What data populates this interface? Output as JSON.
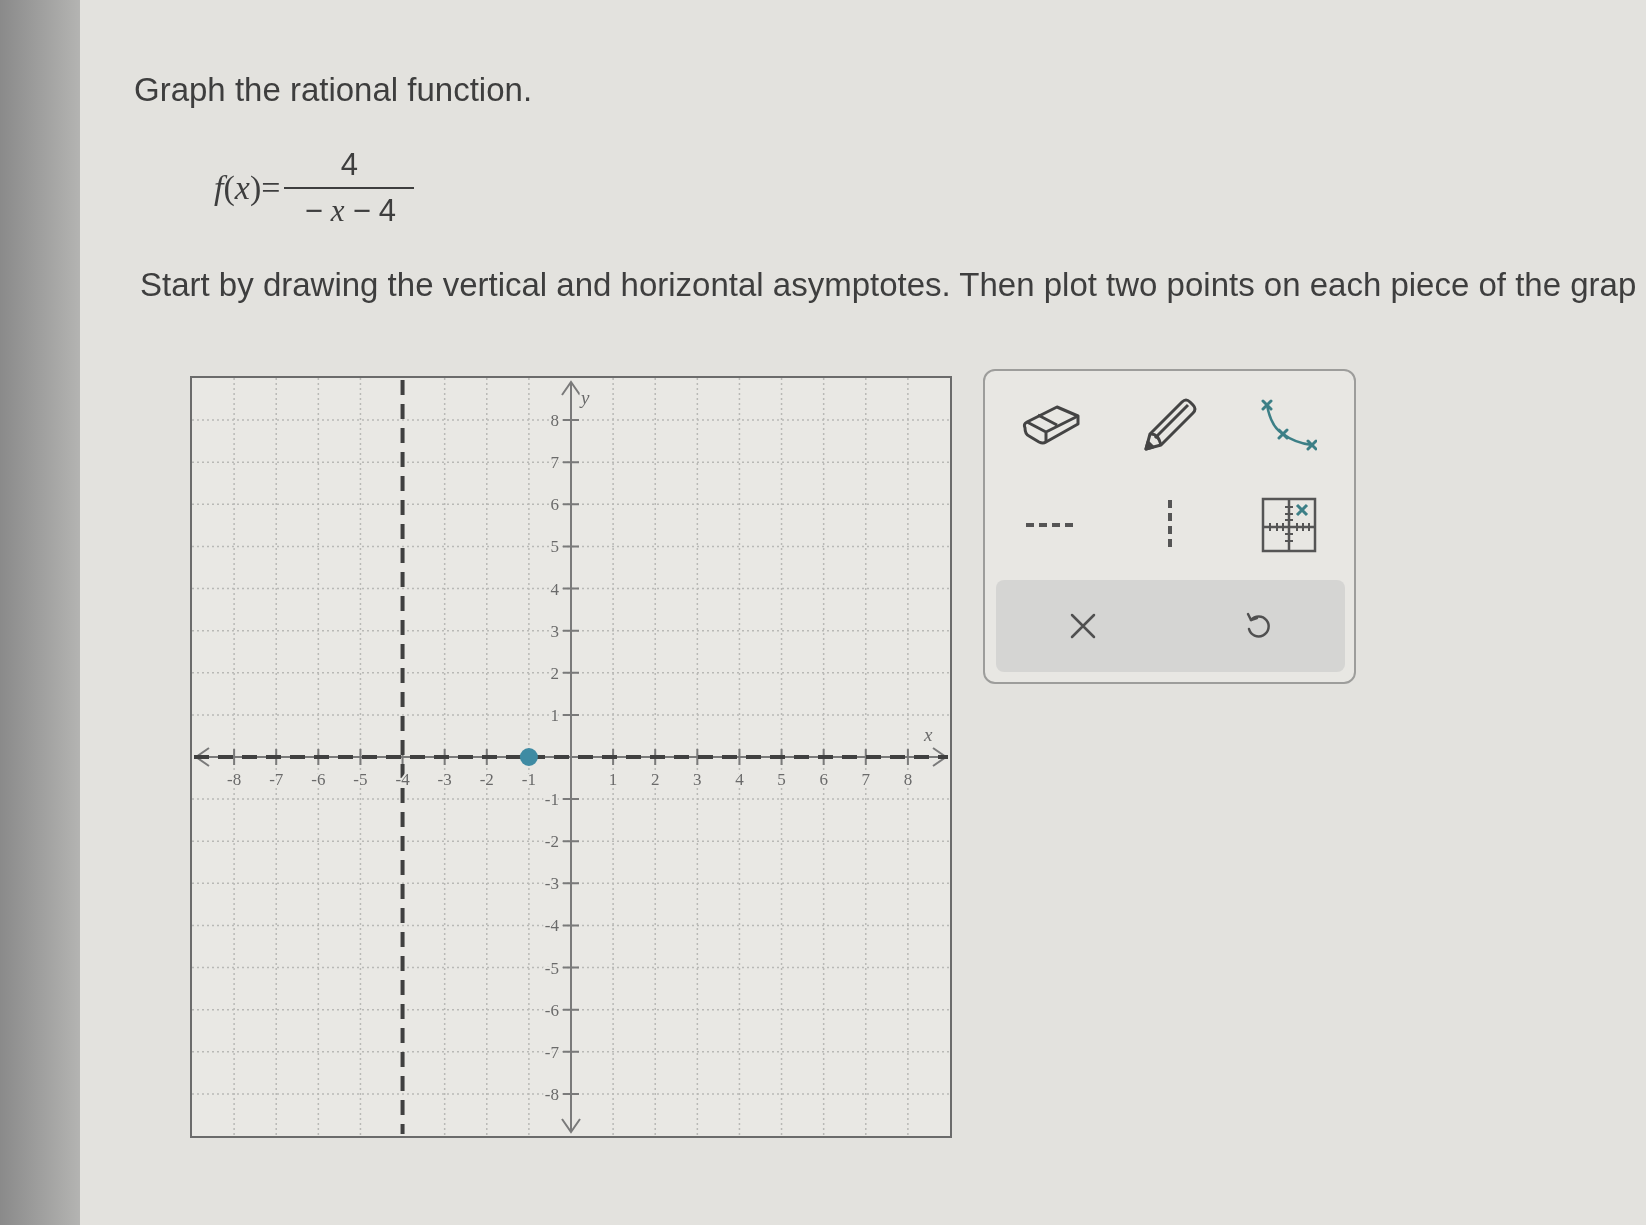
{
  "question": {
    "title": "Graph the rational function.",
    "formula": {
      "lhs": "*f*(*x*)=",
      "numerator": "4",
      "denominator": "−*x*−4"
    },
    "instruction": "Start by drawing the vertical and horizontal asymptotes. Then plot two points on each piece of the grap"
  },
  "graph": {
    "chart_data": [
      {
        "type": "scatter",
        "x": [
          -1
        ],
        "values": [
          0
        ],
        "color": "#3f8ba3",
        "xlabel": "x",
        "ylabel": "y",
        "xlim": [
          -9,
          9
        ],
        "ylim": [
          -9,
          9
        ],
        "xticks": [
          -8,
          -7,
          -6,
          -5,
          -4,
          -3,
          -2,
          -1,
          1,
          2,
          3,
          4,
          5,
          6,
          7,
          8
        ],
        "yticks": [
          -8,
          -7,
          -6,
          -5,
          -4,
          -3,
          -2,
          -1,
          1,
          2,
          3,
          4,
          5,
          6,
          7,
          8
        ],
        "grid": true,
        "ref_lines": [
          {
            "axis": "x",
            "value": -4,
            "line_style": "dashed",
            "color": "#404040"
          },
          {
            "axis": "y",
            "value": 0,
            "line_style": "dashed",
            "color": "#404040"
          }
        ]
      }
    ]
  }
}
